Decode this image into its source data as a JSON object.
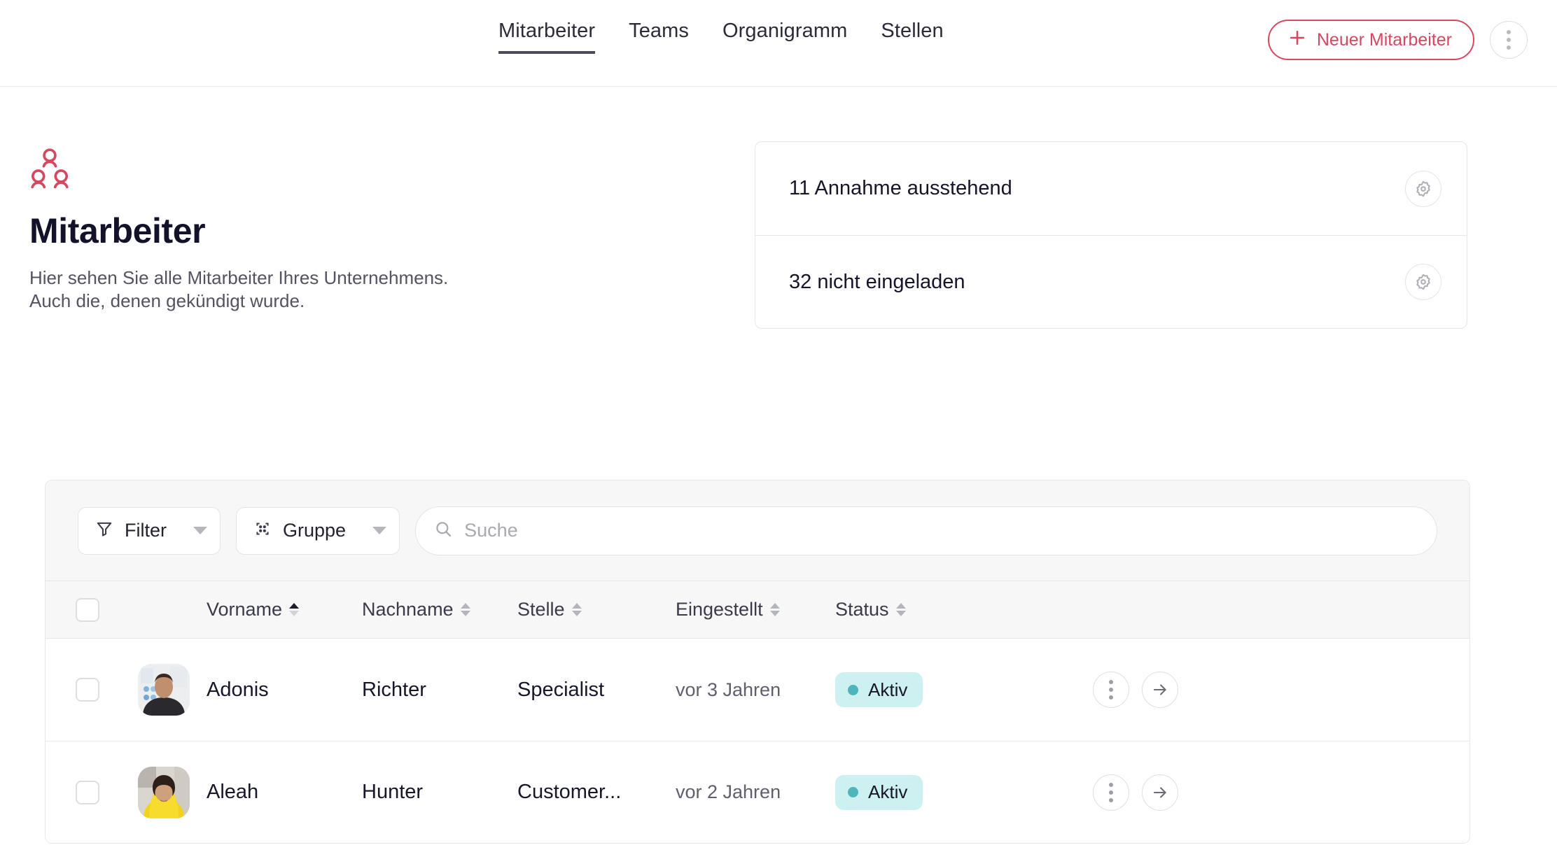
{
  "header": {
    "nav": [
      {
        "label": "Mitarbeiter",
        "active": true
      },
      {
        "label": "Teams",
        "active": false
      },
      {
        "label": "Organigramm",
        "active": false
      },
      {
        "label": "Stellen",
        "active": false
      }
    ],
    "primary_button": {
      "label": "Neuer Mitarbeiter",
      "icon": "plus-icon",
      "color": "#d6485f"
    },
    "overflow_menu_icon": "kebab-menu-icon"
  },
  "page": {
    "icon": "people-group-icon",
    "title": "Mitarbeiter",
    "subtitle_line1": "Hier sehen Sie alle Mitarbeiter Ihres Unternehmens.",
    "subtitle_line2": "Auch die, denen gekündigt wurde."
  },
  "stats": [
    {
      "label": "11 Annahme ausstehend",
      "action_icon": "gear-icon"
    },
    {
      "label": "32 nicht eingeladen",
      "action_icon": "gear-icon"
    }
  ],
  "toolbar": {
    "filter": {
      "label": "Filter",
      "icon": "funnel-icon"
    },
    "group": {
      "label": "Gruppe",
      "icon": "group-nodes-icon"
    },
    "search": {
      "value": "",
      "placeholder": "Suche",
      "icon": "search-icon"
    }
  },
  "table": {
    "columns": [
      {
        "key": "vorname",
        "label": "Vorname",
        "sorted": "asc"
      },
      {
        "key": "nachname",
        "label": "Nachname",
        "sorted": "none"
      },
      {
        "key": "stelle",
        "label": "Stelle",
        "sorted": "none"
      },
      {
        "key": "eingestellt",
        "label": "Eingestellt",
        "sorted": "none"
      },
      {
        "key": "status",
        "label": "Status",
        "sorted": "none"
      }
    ],
    "rows": [
      {
        "first_name": "Adonis",
        "last_name": "Richter",
        "role": "Specialist",
        "hired": "vor 3 Jahren",
        "status": "Aktiv",
        "status_color": "#4fb5bc",
        "status_bg": "#cdf0f0"
      },
      {
        "first_name": "Aleah",
        "last_name": "Hunter",
        "role": "Customer...",
        "hired": "vor 2 Jahren",
        "status": "Aktiv",
        "status_color": "#4fb5bc",
        "status_bg": "#cdf0f0"
      }
    ]
  }
}
